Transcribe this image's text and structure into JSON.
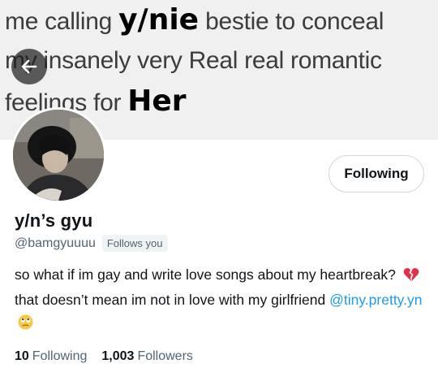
{
  "banner": {
    "line1_pre": "me calling ",
    "line1_bold": "y/nie",
    "line1_post": " bestie to conceal",
    "line2": "my insanely very Real real romantic",
    "line3_pre": "feelings for ",
    "line3_bold": "Her"
  },
  "header": {
    "back_icon": "arrow-left-icon"
  },
  "profile": {
    "display_name": "y/n’s gyu",
    "handle": "@bamgyuuuu",
    "follows_you_badge": "Follows you",
    "follow_button_label": "Following",
    "bio_part1": "so what if im gay and write love songs about my heartbreak?",
    "bio_emoji1": "broken-heart-emoji",
    "bio_part2": "that doesn’t mean im not in love with my girlfriend",
    "bio_mention": "@tiny.pretty.yn",
    "bio_emoji2": "rolling-eyes-emoji"
  },
  "stats": {
    "following_count": "10",
    "following_label": "Following",
    "followers_count": "1,003",
    "followers_label": "Followers"
  },
  "colors": {
    "accent": "#1d9bf0",
    "secondary_text": "#536471"
  }
}
